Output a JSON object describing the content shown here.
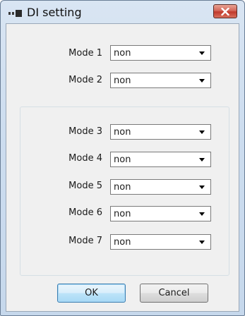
{
  "window": {
    "title": "DI setting"
  },
  "modes": [
    {
      "label": "Mode 1",
      "value": "non"
    },
    {
      "label": "Mode 2",
      "value": "non"
    },
    {
      "label": "Mode 3",
      "value": "non"
    },
    {
      "label": "Mode 4",
      "value": "non"
    },
    {
      "label": "Mode 5",
      "value": "non"
    },
    {
      "label": "Mode 6",
      "value": "non"
    },
    {
      "label": "Mode 7",
      "value": "non"
    }
  ],
  "buttons": {
    "ok": "OK",
    "cancel": "Cancel"
  },
  "icons": {
    "app": "app-icon",
    "close": "close-icon",
    "dropdown": "chevron-down-icon"
  },
  "colors": {
    "title_bar": "#cdddef",
    "close_button": "#c0392b",
    "dialog_background": "#f0f0f0",
    "default_button_border": "#3c7fb1"
  }
}
